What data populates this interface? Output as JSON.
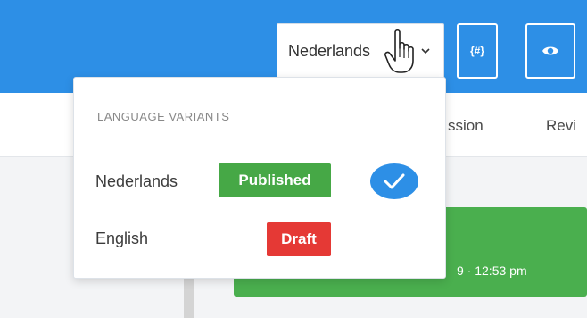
{
  "header": {
    "language_select": {
      "value": "Nederlands"
    },
    "nav_tabs": [
      {
        "label": "ssion"
      },
      {
        "label": "Revi"
      }
    ]
  },
  "dropdown": {
    "heading": "LANGUAGE VARIANTS",
    "variants": [
      {
        "name": "Nederlands",
        "status": "Published",
        "selected": true
      },
      {
        "name": "English",
        "status": "Draft",
        "selected": false
      }
    ]
  },
  "content": {
    "card_timestamp": "9 · 12:53 pm"
  },
  "colors": {
    "header_blue": "#2d8fe6",
    "published_green": "#46a846",
    "draft_red": "#e53935",
    "check_blue": "#2d8fe6",
    "card_green": "#4aaf4e"
  },
  "icons": {
    "code_button": "code-hash-icon",
    "preview_button": "eye-icon",
    "select_caret": "chevron-down-icon",
    "selected_marker": "checkmark-circle-icon",
    "cursor": "hand-pointer-icon"
  }
}
